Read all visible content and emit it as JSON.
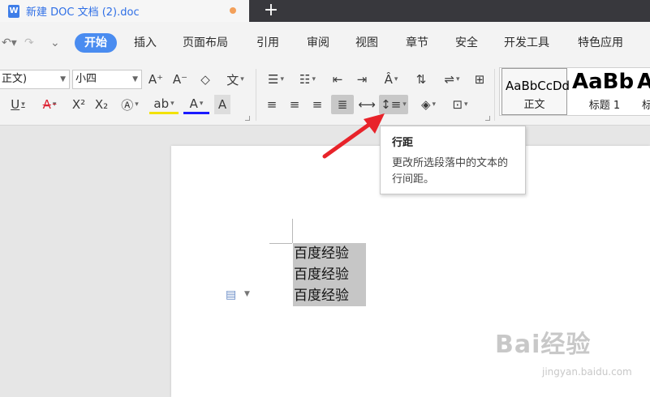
{
  "titlebar": {
    "doc_icon_letter": "W",
    "doc_title": "新建 DOC 文档 (2).doc",
    "new_tab": "+"
  },
  "menubar": {
    "items": [
      "开始",
      "插入",
      "页面布局",
      "引用",
      "审阅",
      "视图",
      "章节",
      "安全",
      "开发工具",
      "特色应用"
    ],
    "active_index": 0
  },
  "ribbon": {
    "font_name": "正文)",
    "font_size": "小四",
    "style_gallery": [
      {
        "sample": "AaBbCcDd",
        "name": "正文"
      },
      {
        "sample": "AaBb",
        "name": "标题 1"
      },
      {
        "sample": "A",
        "name": "标"
      }
    ]
  },
  "tooltip": {
    "title": "行距",
    "body": "更改所选段落中的文本的行间距。"
  },
  "document": {
    "lines": [
      "百度经验",
      "百度经验",
      "百度经验"
    ]
  },
  "watermark": {
    "brand": "Bai经验",
    "url": "jingyan.baidu.com"
  },
  "colors": {
    "accent": "#4a8cf0",
    "arrow": "#e8232a",
    "titlebar_dark": "#38383d",
    "selection": "#c6c6c6"
  }
}
